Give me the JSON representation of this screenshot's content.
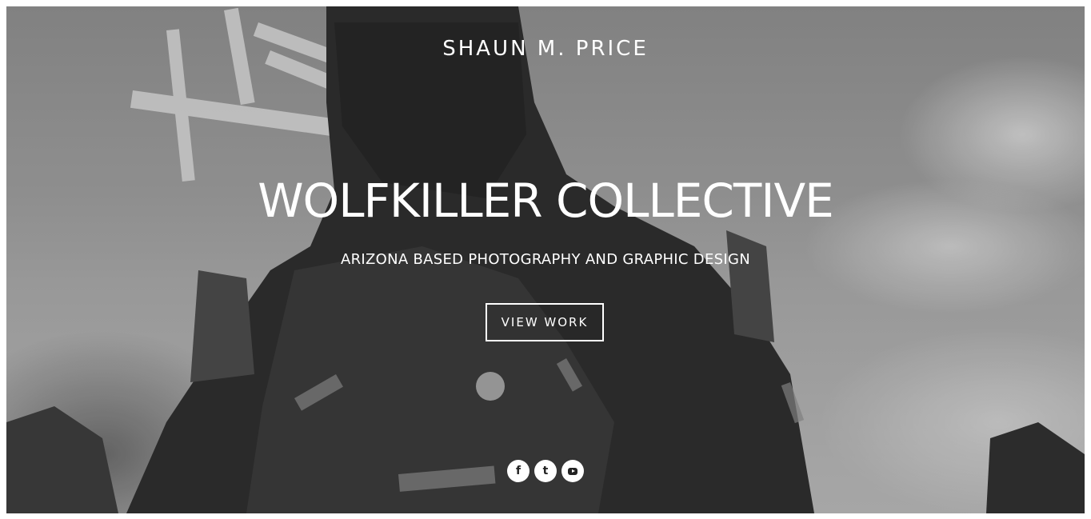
{
  "header": {
    "site_title": "SHAUN M. PRICE"
  },
  "hero": {
    "heading": "WOLFKILLER COLLECTIVE",
    "subheading": "ARIZONA BASED PHOTOGRAPHY AND GRAPHIC DESIGN",
    "cta_label": "VIEW WORK"
  },
  "social": {
    "items": [
      {
        "icon": "facebook-icon",
        "glyph": "f"
      },
      {
        "icon": "tumblr-icon",
        "glyph": "t"
      },
      {
        "icon": "youtube-icon",
        "glyph": ""
      }
    ]
  },
  "colors": {
    "text": "#ffffff",
    "icon_bg": "#ffffff",
    "icon_fg": "#222222"
  }
}
